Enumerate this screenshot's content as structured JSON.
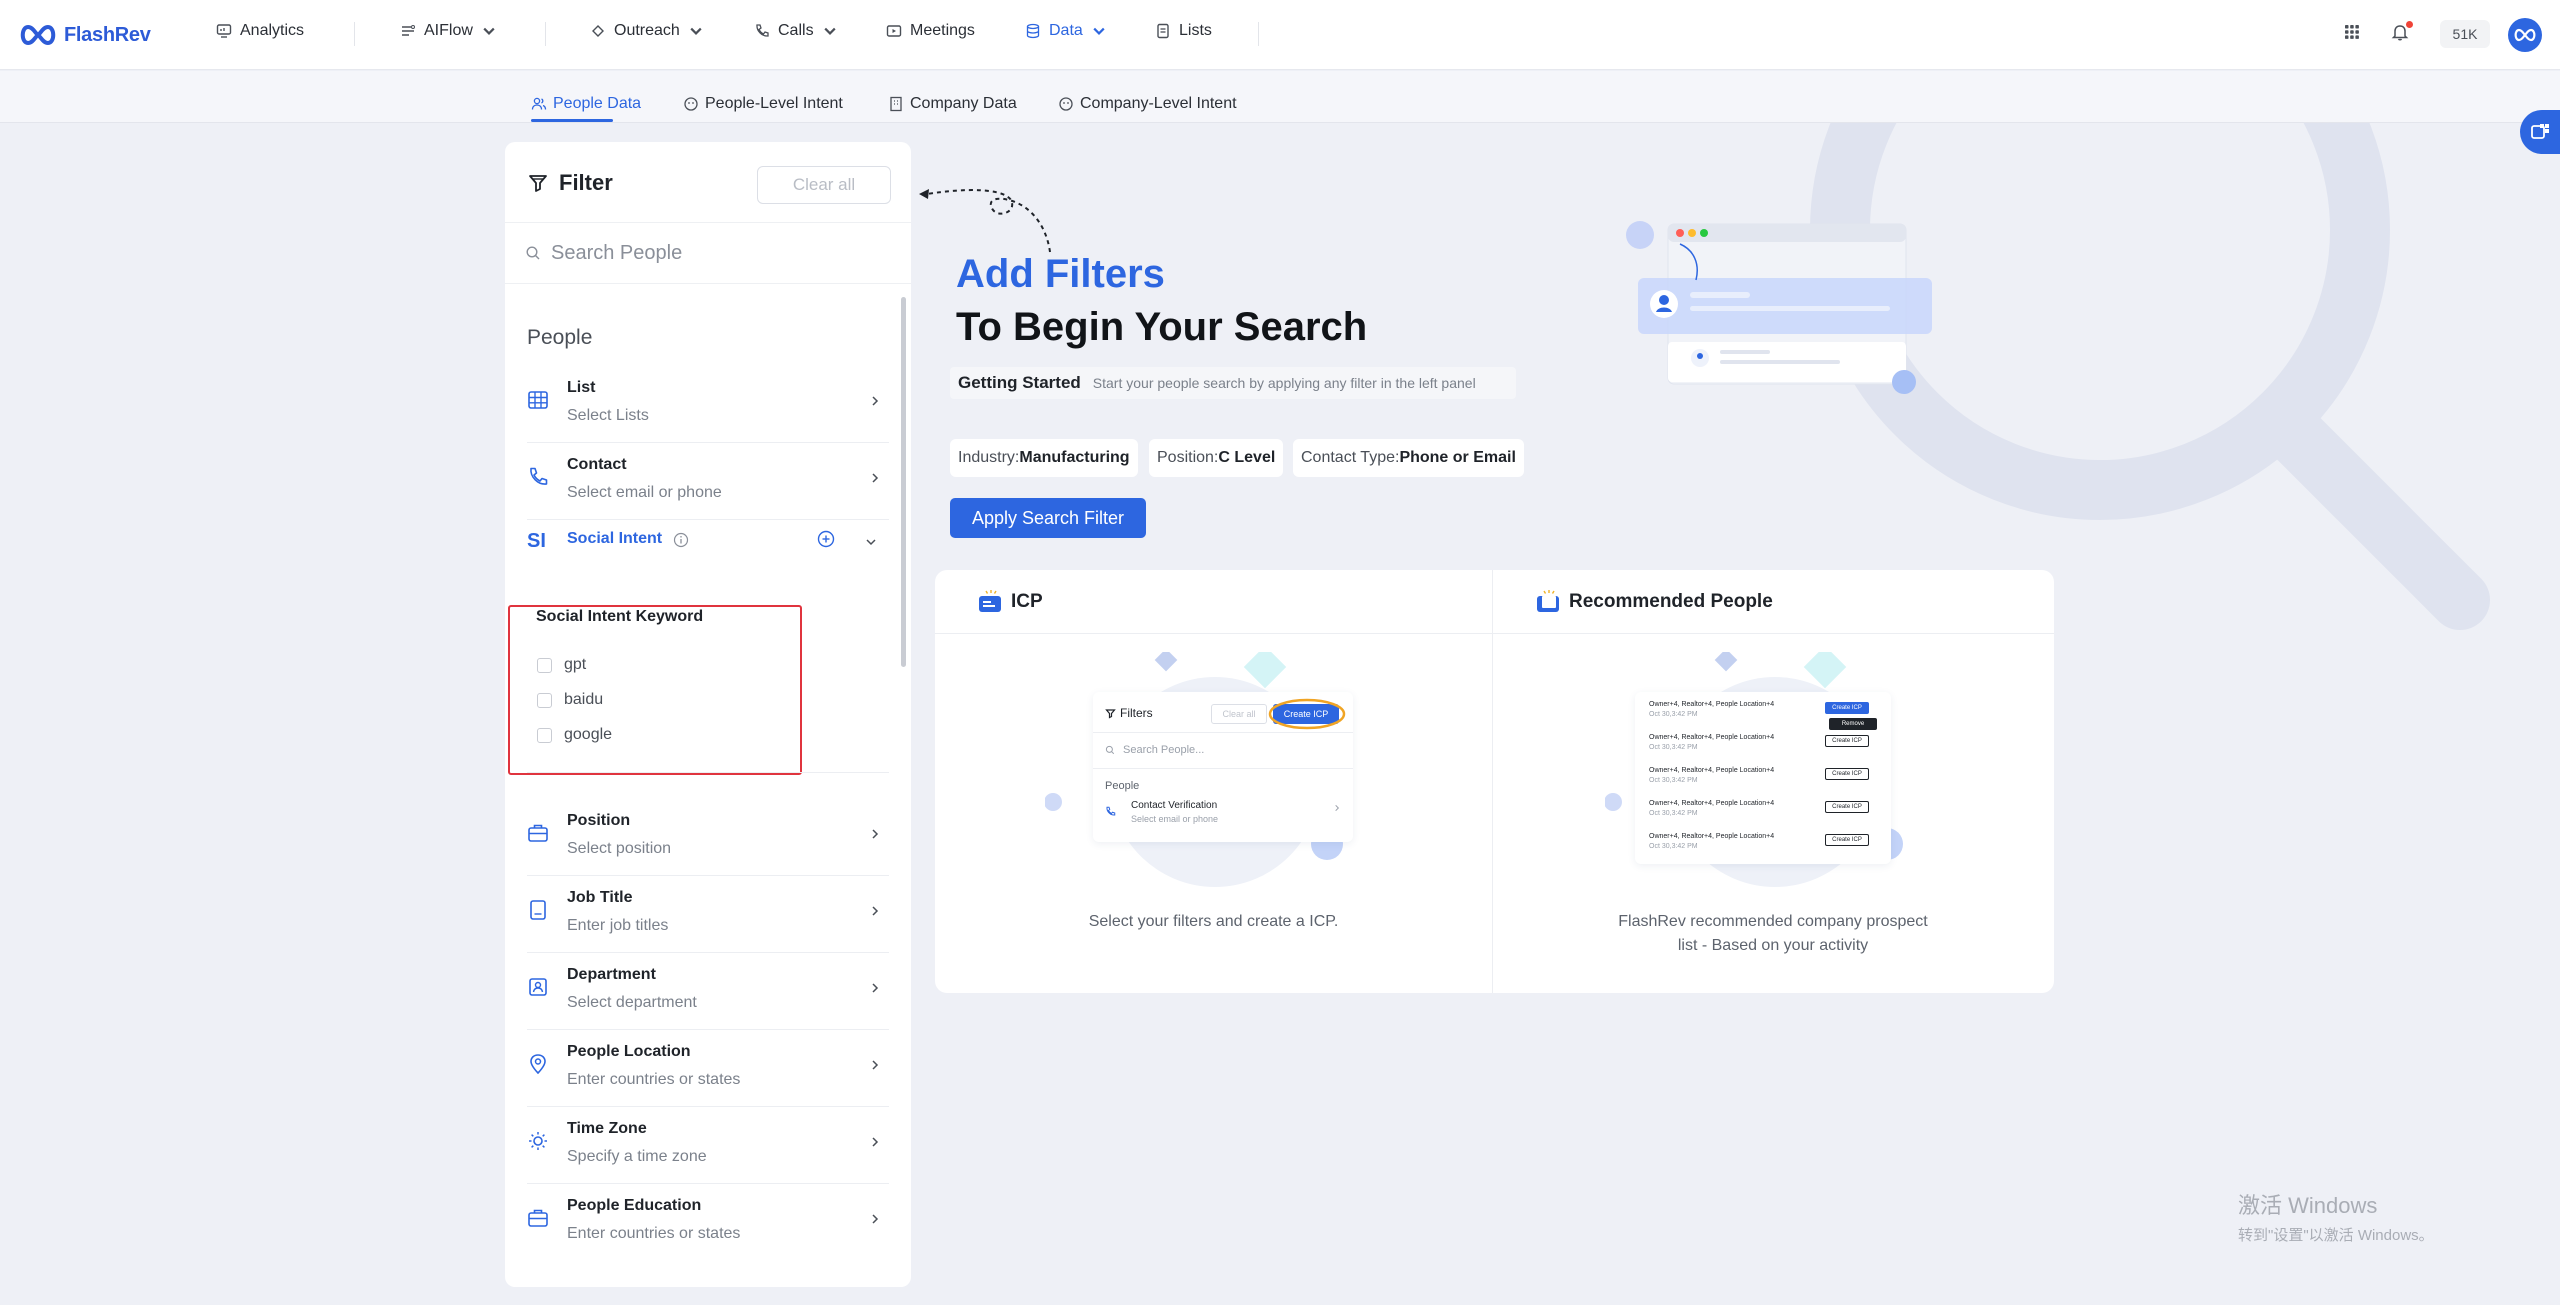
{
  "brand": {
    "name": "FlashRev"
  },
  "nav": {
    "items": [
      {
        "label": "Analytics"
      },
      {
        "label": "AIFlow"
      },
      {
        "label": "Outreach"
      },
      {
        "label": "Calls"
      },
      {
        "label": "Meetings"
      },
      {
        "label": "Data"
      },
      {
        "label": "Lists"
      }
    ],
    "credits": "51K",
    "active": "Data"
  },
  "subnav": {
    "tabs": [
      {
        "label": "People Data"
      },
      {
        "label": "People-Level Intent"
      },
      {
        "label": "Company Data"
      },
      {
        "label": "Company-Level Intent"
      }
    ],
    "active": "People Data"
  },
  "filter": {
    "title": "Filter",
    "clear_label": "Clear all",
    "search_placeholder": "Search People",
    "section": "People",
    "rows_top": [
      {
        "label": "List",
        "sub": "Select Lists",
        "icon": "table-icon"
      },
      {
        "label": "Contact",
        "sub": "Select email or phone",
        "icon": "phone-icon"
      }
    ],
    "social_intent": {
      "badge": "SI",
      "label": "Social Intent",
      "keyword_title": "Social Intent Keyword",
      "keywords": [
        "gpt",
        "baidu",
        "google"
      ]
    },
    "rows_bottom": [
      {
        "label": "Position",
        "sub": "Select position",
        "icon": "briefcase-icon"
      },
      {
        "label": "Job Title",
        "sub": "Enter job titles",
        "icon": "id-card-icon"
      },
      {
        "label": "Department",
        "sub": "Select department",
        "icon": "department-icon"
      },
      {
        "label": "People Location",
        "sub": "Enter countries or states",
        "icon": "location-icon"
      },
      {
        "label": "Time Zone",
        "sub": "Specify a time zone",
        "icon": "sun-icon"
      },
      {
        "label": "People Education",
        "sub": "Enter countries or states",
        "icon": "education-icon"
      }
    ]
  },
  "hero": {
    "title_line1": "Add Filters",
    "title_line2": "To Begin Your Search",
    "getting_started_label": "Getting Started",
    "getting_started_desc": "Start your people search by applying any filter in the left panel",
    "chips": [
      {
        "key": "Industry:",
        "value": "Manufacturing"
      },
      {
        "key": "Position:",
        "value": "C Level"
      },
      {
        "key": "Contact Type:",
        "value": "Phone or Email"
      }
    ],
    "apply_label": "Apply Search Filter"
  },
  "cards": {
    "icp": {
      "title": "ICP",
      "caption": "Select your filters and create a ICP.",
      "mock": {
        "filters_label": "Filters",
        "clear": "Clear all",
        "create": "Create ICP",
        "search": "Search People...",
        "people": "People",
        "contact_title": "Contact Verification",
        "contact_sub": "Select email or phone"
      }
    },
    "recommended": {
      "title": "Recommended People",
      "caption_line1": "FlashRev recommended company prospect",
      "caption_line2": "list - Based on your activity",
      "mock": {
        "row_text": "Owner+4, Realtor+4, People Location+4",
        "row_date": "Oct 30,3:42 PM",
        "btn": "Create ICP",
        "remove": "Remove"
      }
    }
  },
  "watermark": {
    "line1": "激活 Windows",
    "line2": "转到\"设置\"以激活 Windows。"
  },
  "colors": {
    "accent": "#2d66e0",
    "highlight_border": "#e0343e",
    "page_bg": "#eef0f6"
  }
}
